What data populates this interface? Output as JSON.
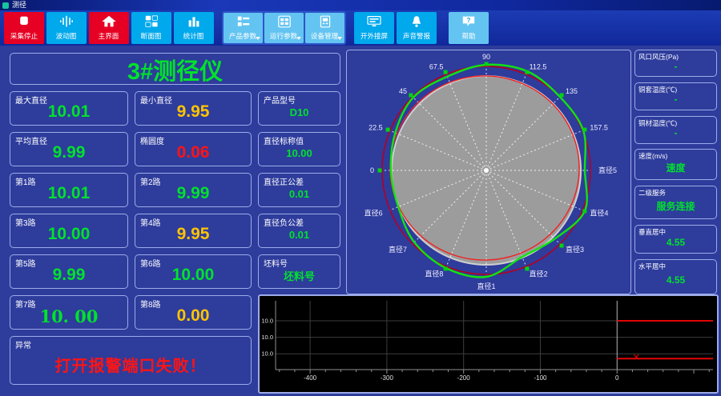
{
  "window": {
    "title": "测径"
  },
  "colors": {
    "green": "#00e22c",
    "yellow": "#ffc400",
    "red": "#ff1414",
    "white": "#ffffff"
  },
  "toolbar": {
    "buttons": [
      {
        "label": "采集停止",
        "style": "red"
      },
      {
        "label": "波动图",
        "style": "cyan"
      },
      {
        "label": "主界面",
        "style": "red"
      },
      {
        "label": "断面图",
        "style": "cyan"
      },
      {
        "label": "统计图",
        "style": "cyan"
      },
      {
        "label": "产品参数",
        "style": "light",
        "dropdown": true
      },
      {
        "label": "运行参数",
        "style": "light",
        "dropdown": true
      },
      {
        "label": "设备管理",
        "style": "light",
        "dropdown": true
      },
      {
        "label": "开外接屏",
        "style": "cyan"
      },
      {
        "label": "声音警报",
        "style": "cyan"
      },
      {
        "label": "帮助",
        "style": "light"
      }
    ]
  },
  "device_title": "3#测径仪",
  "fields": [
    {
      "label": "最大直径",
      "value": "10.01",
      "color": "#00e22c"
    },
    {
      "label": "最小直径",
      "value": "9.95",
      "color": "#ffc400"
    },
    {
      "label": "产品型号",
      "value": "D10",
      "color": "#00e22c"
    },
    {
      "label": "平均直径",
      "value": "9.99",
      "color": "#00e22c"
    },
    {
      "label": "椭圆度",
      "value": "0.06",
      "color": "#ff1414"
    },
    {
      "label": "直径标称值",
      "value": "10.00",
      "color": "#00e22c"
    },
    {
      "label": "第1路",
      "value": "10.01",
      "color": "#00e22c"
    },
    {
      "label": "第2路",
      "value": "9.99",
      "color": "#00e22c"
    },
    {
      "label": "直径正公差",
      "value": "0.01",
      "color": "#00e22c"
    },
    {
      "label": "第3路",
      "value": "10.00",
      "color": "#00e22c"
    },
    {
      "label": "第4路",
      "value": "9.95",
      "color": "#ffc400"
    },
    {
      "label": "直径负公差",
      "value": "0.01",
      "color": "#00e22c"
    },
    {
      "label": "第5路",
      "value": "9.99",
      "color": "#00e22c"
    },
    {
      "label": "第6路",
      "value": "10.00",
      "color": "#00e22c"
    },
    {
      "label": "坯料号",
      "value": "坯料号",
      "color": "#00e22c"
    },
    {
      "label": "第7路",
      "value": "10. 00",
      "color": "#00e22c"
    },
    {
      "label": "第8路",
      "value": "0.00",
      "color": "#ffc400"
    },
    {
      "label": "异常",
      "value": "打开报警端口失败！",
      "color": "#ff1414"
    }
  ],
  "right_panel": [
    {
      "label": "风口风压(Pa)",
      "value": "-",
      "color": "#00e22c"
    },
    {
      "label": "铜套温度(℃)",
      "value": "-",
      "color": "#00e22c"
    },
    {
      "label": "铜材温度(℃)",
      "value": "-",
      "color": "#00e22c"
    },
    {
      "label": "速度(m/s)",
      "value": "速度",
      "color": "#00e22c"
    },
    {
      "label": "二级服务",
      "value": "服务连接",
      "color": "#00e22c"
    },
    {
      "label": "垂直居中",
      "value": "4.55",
      "color": "#00e22c"
    },
    {
      "label": "水平居中",
      "value": "4.55",
      "color": "#00e22c"
    }
  ],
  "chart_data": [
    {
      "name": "cross-section",
      "type": "polar-profile",
      "angle_step_deg": 22.5,
      "outer_circle_ratio": 1.102,
      "inner_circle_ratio": 0.975,
      "labels": [
        {
          "deg": 90,
          "text": "90"
        },
        {
          "deg": 67.5,
          "text": "112.5"
        },
        {
          "deg": 45,
          "text": "135"
        },
        {
          "deg": 22.5,
          "text": "157.5"
        },
        {
          "deg": 0,
          "text": "直径5"
        },
        {
          "deg": 337.5,
          "text": "直径4"
        },
        {
          "deg": 315,
          "text": "直径3"
        },
        {
          "deg": 292.5,
          "text": "直径2"
        },
        {
          "deg": 270,
          "text": "直径1"
        },
        {
          "deg": 247.5,
          "text": "直径8"
        },
        {
          "deg": 225,
          "text": "直径7"
        },
        {
          "deg": 202.5,
          "text": "直径6"
        },
        {
          "deg": 180,
          "text": "0"
        },
        {
          "deg": 157.5,
          "text": "22.5"
        },
        {
          "deg": 135,
          "text": "45"
        },
        {
          "deg": 112.5,
          "text": "67.5"
        }
      ],
      "profile": [
        {
          "deg": 0,
          "ratio": 1.042
        },
        {
          "deg": 22.5,
          "ratio": 1.11
        },
        {
          "deg": 45,
          "ratio": 1.102
        },
        {
          "deg": 67.5,
          "ratio": 1.136
        },
        {
          "deg": 90,
          "ratio": 1.119
        },
        {
          "deg": 112.5,
          "ratio": 1.076
        },
        {
          "deg": 135,
          "ratio": 1.093
        },
        {
          "deg": 157.5,
          "ratio": 1.042
        },
        {
          "deg": 180,
          "ratio": 1.008
        },
        {
          "deg": 202.5,
          "ratio": 1.008
        },
        {
          "deg": 225,
          "ratio": 1.076
        },
        {
          "deg": 247.5,
          "ratio": 1.119
        },
        {
          "deg": 270,
          "ratio": 1.127
        },
        {
          "deg": 292.5,
          "ratio": 0.992
        },
        {
          "deg": 315,
          "ratio": 1.025
        },
        {
          "deg": 337.5,
          "ratio": 1.127
        }
      ],
      "marker_degs": [
        22.5,
        45,
        67.5,
        90,
        112.5,
        135,
        157.5,
        180,
        247.5,
        292.5,
        315,
        337.5
      ],
      "colors": {
        "body": "#9c9c9c",
        "body_edge": "#d0d0d0",
        "outer_circle": "#b40020",
        "inner_circle": "#f22020",
        "profile": "#12e212",
        "spokes": "#ffffff",
        "labels": "#eeeeff",
        "marker": "#00d414"
      }
    },
    {
      "name": "trend",
      "type": "line",
      "x_range": [
        -445,
        125
      ],
      "x_ticks": [
        -400,
        -300,
        -200,
        -100,
        0
      ],
      "minor_tick_step": 20,
      "y_axis_labels": [
        "10.0",
        "10.0",
        "10.0"
      ],
      "gridline_fracs": [
        0.29,
        0.53,
        0.77
      ],
      "series": [
        {
          "name": "upper-trace",
          "color": "#e00505",
          "y_frac": 0.29,
          "x_from": 0,
          "x_to": 125
        },
        {
          "name": "lower-trace",
          "color": "#e00505",
          "y_frac": 0.84,
          "x_from": 0,
          "x_to": 125,
          "marker_x": 25
        }
      ],
      "colors": {
        "bg": "#000000",
        "grid": "#3d3d3d",
        "zero_line": "#b8b8b8",
        "axis": "#909090",
        "text": "#e0e0e0"
      }
    }
  ]
}
